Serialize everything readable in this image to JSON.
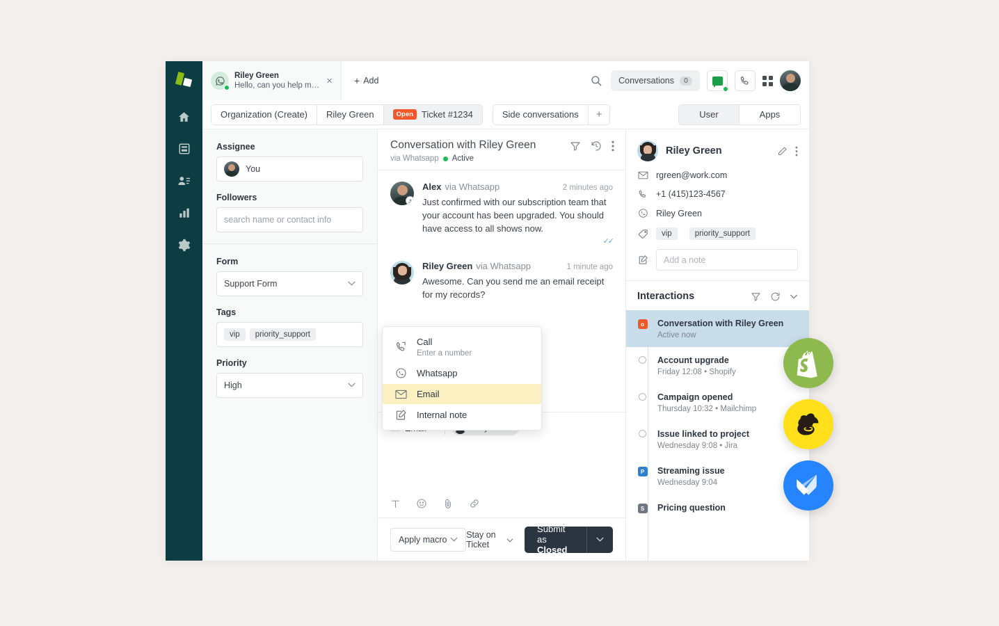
{
  "colors": {
    "page_bg": "#f3efec",
    "rail_bg": "#0d3c42",
    "accent_green": "#8cbb16",
    "badge_open": "#f1582c",
    "highlight_yellow": "#faf0c2",
    "active_row_blue": "#c9dcea",
    "submit_dark": "#2b3541",
    "shopify_green": "#8db94f",
    "mailchimp_yellow": "#ffe01b",
    "jira_blue": "#2684ff"
  },
  "rail": {
    "logo": "logo-icon",
    "items": [
      {
        "name": "home-icon",
        "label": "Home"
      },
      {
        "name": "inbox-icon",
        "label": "Inbox"
      },
      {
        "name": "contacts-icon",
        "label": "Contacts"
      },
      {
        "name": "analytics-icon",
        "label": "Analytics"
      },
      {
        "name": "settings-icon",
        "label": "Settings"
      }
    ]
  },
  "topbar": {
    "conversation_chip": {
      "name": "Riley Green",
      "preview": "Hello, can you help me?",
      "channel_icon": "whatsapp-icon",
      "online": true,
      "close_label": "×"
    },
    "add_label": "Add",
    "search_icon": "search-icon",
    "conversations_label": "Conversations",
    "conversations_count": "0",
    "chat_icon": "chat-icon",
    "phone_icon": "phone-icon",
    "apps_grid_icon": "grid-icon",
    "avatar": "user-avatar"
  },
  "tabs": {
    "left": [
      {
        "label": "Organization (Create)",
        "active": false
      },
      {
        "label": "Riley Green",
        "active": false
      },
      {
        "label": "Ticket #1234",
        "badge": "Open",
        "active": true
      }
    ],
    "side": {
      "label": "Side conversations",
      "plus": "+"
    },
    "toggle": [
      {
        "label": "User",
        "active": true
      },
      {
        "label": "Apps",
        "active": false
      }
    ]
  },
  "properties": {
    "assignee_label": "Assignee",
    "assignee_value": "You",
    "followers_label": "Followers",
    "followers_placeholder": "search name or contact info",
    "form_label": "Form",
    "form_value": "Support Form",
    "tags_label": "Tags",
    "tags": [
      "vip",
      "priority_support"
    ],
    "priority_label": "Priority",
    "priority_value": "High"
  },
  "conversation": {
    "title": "Conversation with Riley Green",
    "via": "via Whatsapp",
    "status": "Active",
    "icons": [
      "filter-icon",
      "history-icon",
      "more-vertical-icon"
    ],
    "messages": [
      {
        "author": "Alex",
        "via": "via Whatsapp",
        "time": "2 minutes ago",
        "text": "Just confirmed with our subscription team that your account has been upgraded. You should have access to all shows now.",
        "read_receipt": "✓✓"
      },
      {
        "author": "Riley Green",
        "via": "via Whatsapp",
        "time": "1 minute ago",
        "text": "Awesome. Can you send me an email receipt for my records?",
        "read_receipt": ""
      }
    ]
  },
  "channel_menu": {
    "items": [
      {
        "title": "Call",
        "subtitle": "Enter a number",
        "icon": "phone-icon",
        "highlighted": false
      },
      {
        "title": "Whatsapp",
        "subtitle": "",
        "icon": "whatsapp-icon",
        "highlighted": false
      },
      {
        "title": "Email",
        "subtitle": "",
        "icon": "mail-icon",
        "highlighted": true
      },
      {
        "title": "Internal note",
        "subtitle": "",
        "icon": "note-icon",
        "highlighted": false
      }
    ]
  },
  "composer": {
    "channel": "Email",
    "channel_icon": "mail-icon",
    "recipient": "Riley Green",
    "tools": [
      "text-format-icon",
      "emoji-icon",
      "attachment-icon",
      "link-icon"
    ]
  },
  "actionbar": {
    "macro_label": "Apply macro",
    "stay_label": "Stay on Ticket",
    "submit_prefix": "Submit as ",
    "submit_state": "Closed"
  },
  "contact": {
    "name": "Riley Green",
    "edit_icon": "pencil-icon",
    "more_icon": "more-vertical-icon",
    "rows": [
      {
        "icon": "mail-icon",
        "value": "rgreen@work.com"
      },
      {
        "icon": "phone-icon",
        "value": "+1 (415)123-4567"
      },
      {
        "icon": "whatsapp-icon",
        "value": "Riley Green"
      }
    ],
    "tags_icon": "tag-icon",
    "tags": [
      "vip",
      "priority_support"
    ],
    "note_icon": "note-icon",
    "note_placeholder": "Add a note"
  },
  "interactions": {
    "title": "Interactions",
    "icons": [
      "filter-icon",
      "refresh-icon",
      "chevron-down-icon"
    ],
    "items": [
      {
        "title": "Conversation with Riley Green",
        "subtitle": "Active now",
        "marker": "square-o",
        "marker_label": "o",
        "active": true
      },
      {
        "title": "Account upgrade",
        "subtitle": "Friday 12:08 • Shopify",
        "marker": "circle",
        "marker_label": "",
        "active": false
      },
      {
        "title": "Campaign opened",
        "subtitle": "Thursday 10:32 • Mailchimp",
        "marker": "circle",
        "marker_label": "",
        "active": false
      },
      {
        "title": "Issue linked to project",
        "subtitle": "Wednesday 9:08 • Jira",
        "marker": "circle",
        "marker_label": "",
        "active": false
      },
      {
        "title": "Streaming issue",
        "subtitle": "Wednesday 9:04",
        "marker": "square-p",
        "marker_label": "P",
        "active": false
      },
      {
        "title": "Pricing question",
        "subtitle": "",
        "marker": "square-s",
        "marker_label": "S",
        "active": false
      }
    ]
  },
  "app_badges": [
    {
      "name": "shopify-badge",
      "label": "Shopify"
    },
    {
      "name": "mailchimp-badge",
      "label": "Mailchimp"
    },
    {
      "name": "jira-badge",
      "label": "Jira"
    }
  ]
}
